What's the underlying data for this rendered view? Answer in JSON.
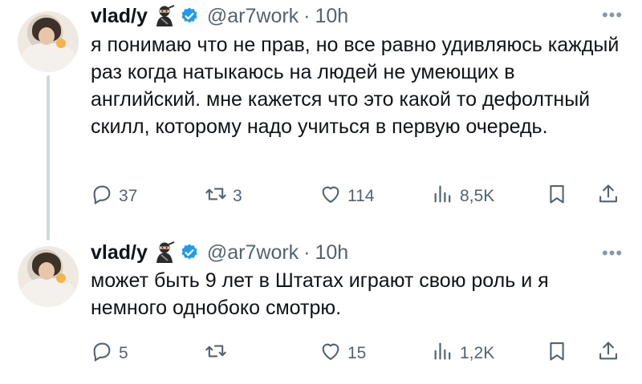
{
  "tweets": [
    {
      "author": "vlad/y",
      "handle": "@ar7work",
      "separator": "·",
      "time": "10h",
      "more": "•••",
      "text": "я понимаю что не прав, но все равно удивляюсь каждый раз когда натыкаюсь на людей не умеющих в английский. мне кажется что это какой то дефолтный скилл, которому надо учиться в первую очередь.",
      "replies": "37",
      "reposts": "3",
      "likes": "114",
      "views": "8,5K"
    },
    {
      "author": "vlad/y",
      "handle": "@ar7work",
      "separator": "·",
      "time": "10h",
      "more": "•••",
      "text": "может быть 9 лет в Штатах играют свою роль и я немного однобоко смотрю.",
      "replies": "5",
      "reposts": "",
      "likes": "15",
      "views": "1,2K"
    }
  ],
  "colors": {
    "text": "#0f1419",
    "muted": "#536471",
    "verified": "#1d9bf0",
    "thread_line": "#cfd9de"
  },
  "icons": [
    "ninja-emoji-icon",
    "verified-badge-icon",
    "more-icon",
    "reply-icon",
    "repost-icon",
    "like-icon",
    "views-icon",
    "bookmark-icon",
    "share-icon"
  ]
}
